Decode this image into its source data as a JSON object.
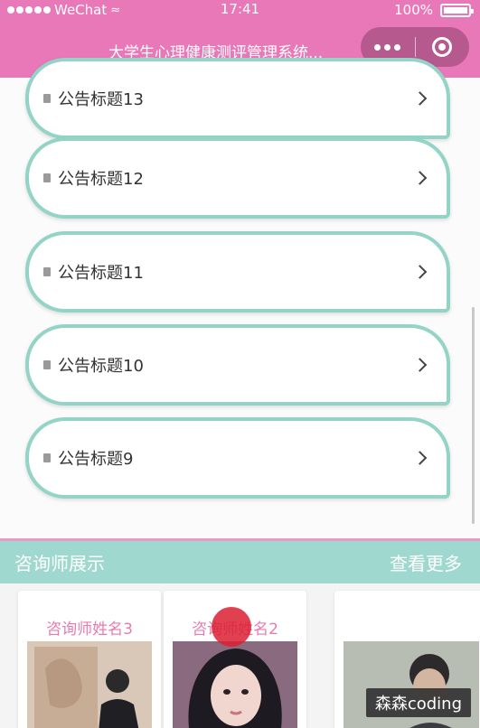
{
  "status_bar": {
    "carrier": "WeChat",
    "time": "17:41",
    "battery": "100%"
  },
  "nav": {
    "title": "大学生心理健康测评管理系统..."
  },
  "notices": [
    {
      "title": "公告标题13"
    },
    {
      "title": "公告标题12"
    },
    {
      "title": "公告标题11"
    },
    {
      "title": "公告标题10"
    },
    {
      "title": "公告标题9"
    }
  ],
  "counselors": {
    "section_title": "咨询师展示",
    "more_label": "查看更多",
    "items": [
      {
        "name": "咨询师姓名3"
      },
      {
        "name": "咨询师姓名2"
      },
      {
        "name": ""
      }
    ]
  },
  "watermark": "森森coding",
  "colors": {
    "nav_bg": "#e878b8",
    "card_border": "#93d4c6",
    "section_bg": "#9fd8cf",
    "name_color": "#e97aaf"
  }
}
